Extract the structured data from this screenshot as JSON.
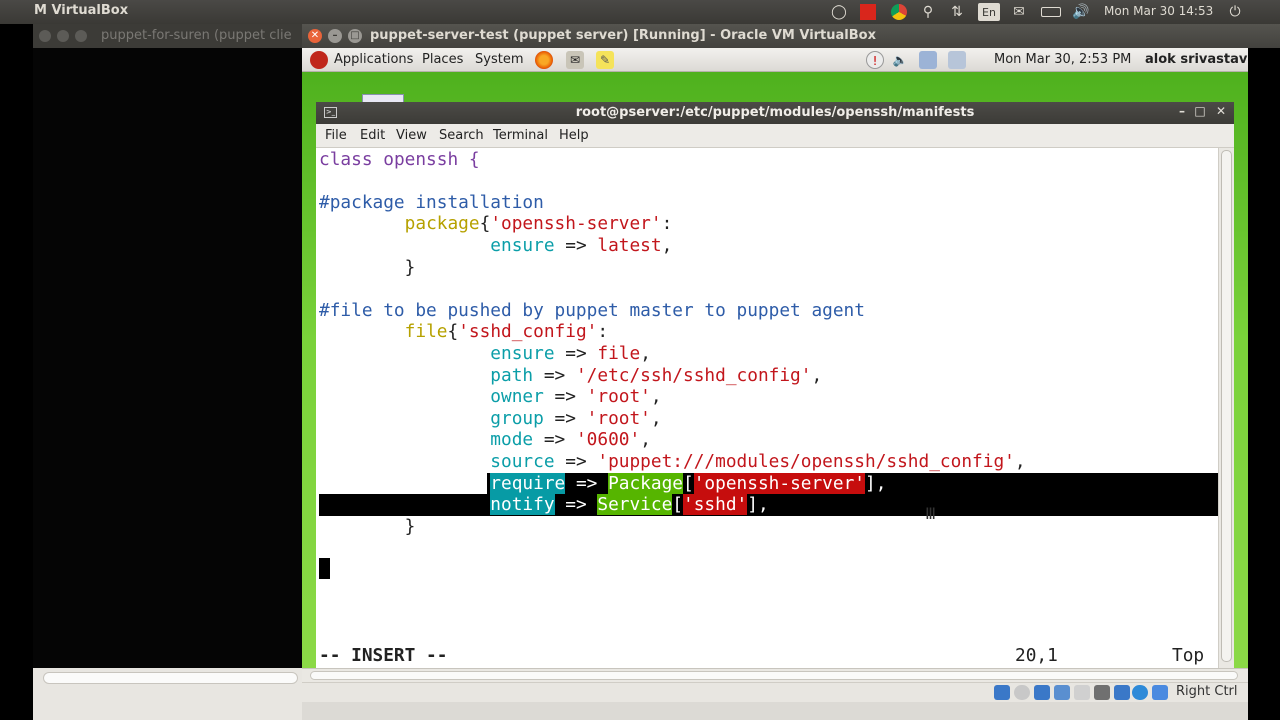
{
  "host": {
    "title": "M VirtualBox",
    "clock": "Mon Mar 30 14:53",
    "lang": "En",
    "icons": [
      "bulb-icon",
      "red-app-icon",
      "chrome-icon",
      "search-icon",
      "network-arrows-icon",
      "keyboard-lang-icon",
      "mail-icon",
      "battery-icon",
      "volume-icon",
      "power-icon"
    ]
  },
  "bg_vm": {
    "title": "puppet-for-suren (puppet clie"
  },
  "vbox": {
    "title": "puppet-server-test (puppet server) [Running] - Oracle VM VirtualBox",
    "host_key": "Right Ctrl"
  },
  "guest_panel": {
    "applications": "Applications",
    "places": "Places",
    "system": "System",
    "clock": "Mon Mar 30,  2:53 PM",
    "user": "alok srivastava"
  },
  "terminal": {
    "title": "root@pserver:/etc/puppet/modules/openssh/manifests",
    "menu": [
      "File",
      "Edit",
      "View",
      "Search",
      "Terminal",
      "Help"
    ],
    "status_mode": "-- INSERT --",
    "status_pos": "20,1",
    "status_scroll": "Top"
  },
  "code": {
    "l1_kw": "class",
    "l1_rest": " openssh {",
    "l3": "#package installation",
    "l4_kw": "package",
    "l4_str": "'openssh-server'",
    "l4_end": ":",
    "l5_attr": "ensure",
    "l5_arrow": " => ",
    "l5_val": "latest",
    "l5_end": ",",
    "l6": "}",
    "l8": "#file to be pushed by puppet master to puppet agent",
    "l9_kw": "file",
    "l9_str": "'sshd_config'",
    "l9_end": ":",
    "l10_attr": "ensure",
    "l10_val": "file",
    "l11_attr": "path",
    "l11_val": "'/etc/ssh/sshd_config'",
    "l12_attr": "owner",
    "l12_val": "'root'",
    "l13_attr": "group",
    "l13_val": "'root'",
    "l14_attr": "mode",
    "l14_val": "'0600'",
    "l15_attr": "source",
    "l15_val": "'puppet:///modules/openssh/sshd_config'",
    "l16_attr": "require",
    "l16_type": "Package",
    "l16_val": "'openssh-server'",
    "l17_attr": "notify",
    "l17_type": "Service",
    "l17_val": "'sshd'",
    "l18": "}"
  }
}
